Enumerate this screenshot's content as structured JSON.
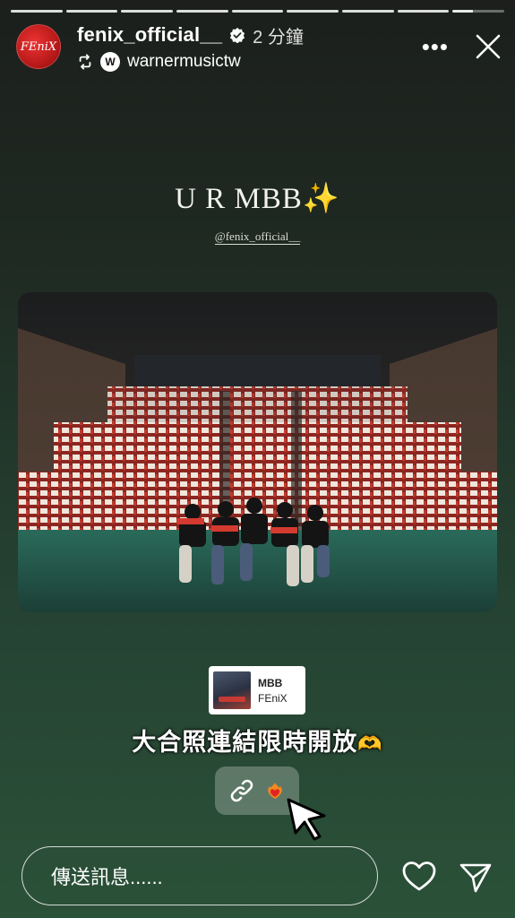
{
  "header": {
    "avatar_text": "FEniX",
    "username": "fenix_official__",
    "time": "2 分鐘",
    "reposted_from": "warnermusictw",
    "wmg_logo_text": "W",
    "menu_label": "•••"
  },
  "story": {
    "title": "U R MBB✨",
    "mention": "@fenix_official__",
    "music": {
      "title": "MBB",
      "artist": "FEniX"
    },
    "caption": "大合照連結限時開放",
    "caption_emoji": "🫶"
  },
  "reply": {
    "placeholder": "傳送訊息......"
  },
  "progress": {
    "segments": 9,
    "active_fraction": 0.4
  },
  "colors": {
    "accent_red": "#b01616",
    "background_bottom": "#2b5138"
  }
}
